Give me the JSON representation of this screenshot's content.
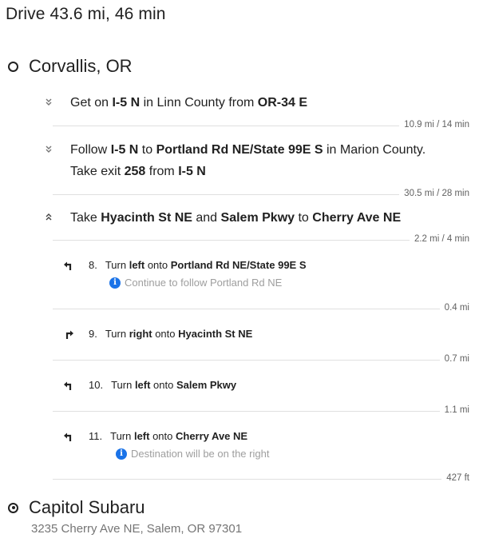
{
  "summary": "Drive 43.6 mi, 46 min",
  "origin": {
    "name": "Corvallis, OR"
  },
  "groups": [
    {
      "expanded": false,
      "line1": {
        "p1": "Get on ",
        "b1": "I-5 N",
        "p2": " in Linn County from ",
        "b2": "OR-34 E"
      },
      "distance": "10.9 mi / 14 min"
    },
    {
      "expanded": false,
      "line1": {
        "p1": "Follow ",
        "b1": "I-5 N",
        "p2": " to ",
        "b2": "Portland Rd NE/State 99E S",
        "p3": " in Marion County."
      },
      "line2": {
        "p1": "Take exit ",
        "b1": "258",
        "p2": " from ",
        "b2": "I-5 N"
      },
      "distance": "30.5 mi / 28 min"
    },
    {
      "expanded": true,
      "line1": {
        "p1": "Take ",
        "b1": "Hyacinth St NE",
        "p2": " and ",
        "b2": "Salem Pkwy",
        "p3": " to ",
        "b3": "Cherry Ave NE"
      },
      "distance": "2.2 mi / 4 min"
    }
  ],
  "steps": [
    {
      "num": "8.",
      "p1": "Turn ",
      "b1": "left",
      "p2": " onto ",
      "b2": "Portland Rd NE/State 99E S",
      "icon": "turn-left-icon",
      "note": "Continue to follow Portland Rd NE",
      "distance": "0.4 mi"
    },
    {
      "num": "9.",
      "p1": "Turn ",
      "b1": "right",
      "p2": " onto ",
      "b2": "Hyacinth St NE",
      "icon": "turn-right-icon",
      "distance": "0.7 mi"
    },
    {
      "num": "10.",
      "p1": "Turn ",
      "b1": "left",
      "p2": " onto ",
      "b2": "Salem Pkwy",
      "icon": "turn-left-icon",
      "distance": "1.1 mi"
    },
    {
      "num": "11.",
      "p1": "Turn ",
      "b1": "left",
      "p2": " onto ",
      "b2": "Cherry Ave NE",
      "icon": "turn-left-icon",
      "note": "Destination will be on the right",
      "distance": "427 ft"
    }
  ],
  "destination": {
    "name": "Capitol Subaru",
    "address": "3235 Cherry Ave NE, Salem, OR 97301"
  },
  "colors": {
    "info_blue": "#1a73e8",
    "separator": "#e0e0e0",
    "muted_text": "#757575"
  }
}
